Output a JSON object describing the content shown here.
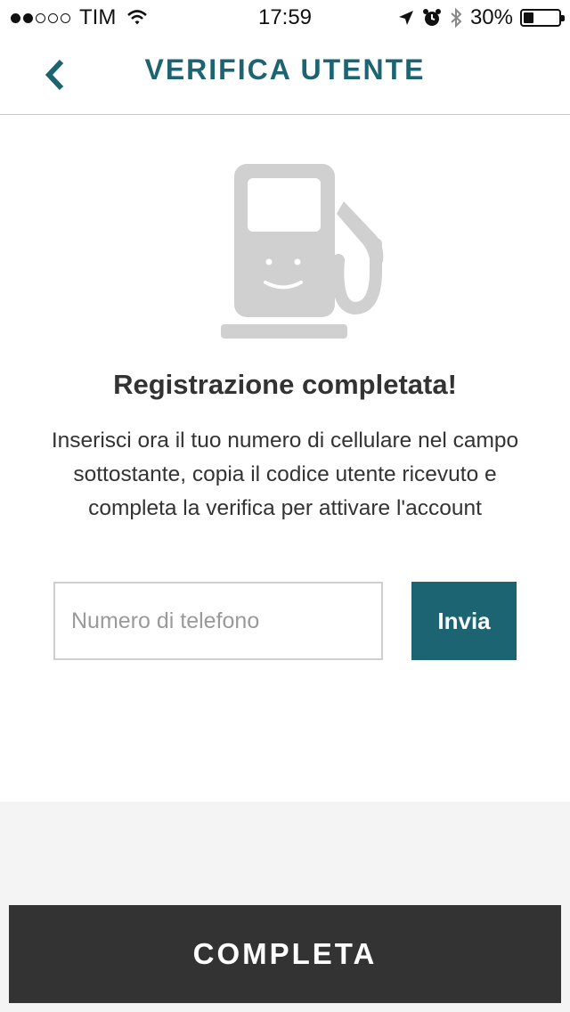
{
  "status_bar": {
    "signal_dots": [
      true,
      true,
      false,
      false,
      false
    ],
    "carrier": "TIM",
    "time": "17:59",
    "battery": "30%",
    "battery_level": 0.3,
    "icons": [
      "wifi-icon",
      "location-arrow-icon",
      "alarm-icon",
      "bluetooth-icon",
      "battery-icon"
    ]
  },
  "header": {
    "title": "VERIFICA UTENTE",
    "back_icon": "chevron-left-icon"
  },
  "illustration": "fuel-pump-icon",
  "content": {
    "title": "Registrazione completata!",
    "description": "Inserisci ora il tuo numero di cellulare nel campo sottostante, copia il codice utente ricevuto e completa la verifica per attivare l'account"
  },
  "phone_form": {
    "placeholder": "Numero di telefono",
    "value": "",
    "send_label": "Invia"
  },
  "footer": {
    "complete_label": "COMPLETA"
  },
  "colors": {
    "accent": "#1c6472",
    "dark_button": "#333333",
    "illustration_gray": "#d0d0d0",
    "footer_bg": "#f4f4f4"
  }
}
